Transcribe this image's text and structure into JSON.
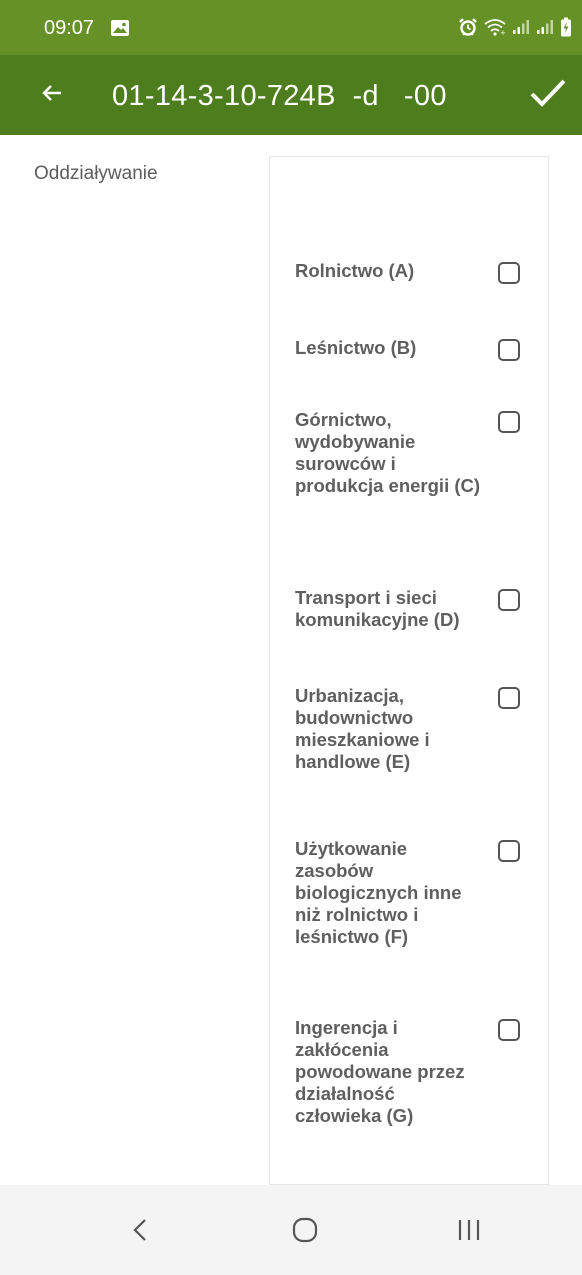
{
  "status_bar": {
    "time": "09:07",
    "icons": [
      "gallery-icon",
      "alarm-icon",
      "wifi-icon",
      "signal-icon",
      "signal-icon",
      "battery-charging-icon"
    ]
  },
  "app_bar": {
    "title": "01-14-3-10-724B  -d   -00",
    "back_icon": "arrow-left-icon",
    "confirm_icon": "checkmark-icon"
  },
  "form": {
    "field_label": "Oddziaływanie",
    "options": [
      {
        "label": "Rolnictwo (A)",
        "checked": false
      },
      {
        "label": "Leśnictwo (B)",
        "checked": false
      },
      {
        "label": "Górnictwo, wydobywanie surowców i produkcja energii (C)",
        "checked": false
      },
      {
        "label": "Transport i sieci komunikacyjne (D)",
        "checked": false
      },
      {
        "label": "Urbanizacja, budownictwo mieszkaniowe i handlowe (E)",
        "checked": false
      },
      {
        "label": "Użytkowanie zasobów biologicznych inne niż rolnictwo i leśnictwo (F)",
        "checked": false
      },
      {
        "label": "Ingerencja i zakłócenia powodowane przez działalność człowieka (G)",
        "checked": false
      }
    ]
  },
  "nav_bar": {
    "icons": [
      "nav-back-icon",
      "nav-home-icon",
      "nav-recent-apps-icon"
    ]
  },
  "colors": {
    "status_bar_bg": "#659126",
    "app_bar_bg": "#4e7d1e",
    "option_text": "#5f5f5f",
    "label_text": "#5d5d5d",
    "nav_bar_bg": "#f4f4f4"
  }
}
